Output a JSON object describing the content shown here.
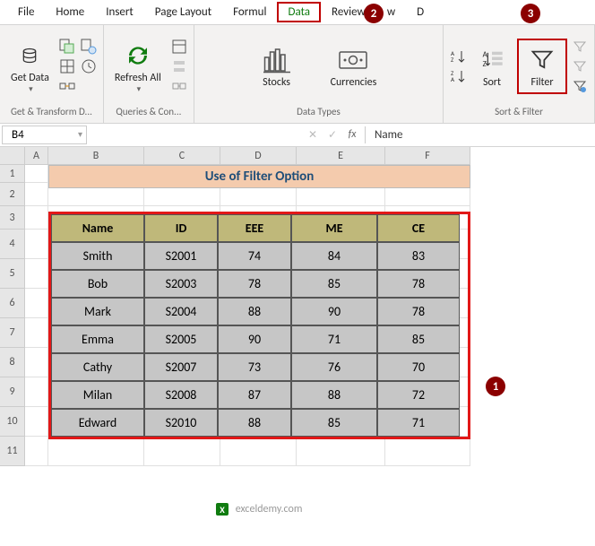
{
  "tabs": [
    "File",
    "Home",
    "Insert",
    "Page Layout",
    "Formul",
    "Data",
    "Review",
    "w",
    "D"
  ],
  "activeTab": "Data",
  "ribbon": {
    "getData": "Get Data",
    "refreshAll": "Refresh All",
    "stocks": "Stocks",
    "currencies": "Currencies",
    "sort": "Sort",
    "filter": "Filter",
    "group1": "Get & Transform D...",
    "group2": "Queries & Con...",
    "group3": "Data Types",
    "group4": "Sort & Filter"
  },
  "nameBox": "B4",
  "formulaBar": "Name",
  "colHeaders": [
    "A",
    "B",
    "C",
    "D",
    "E",
    "F"
  ],
  "rowHeaders": [
    "1",
    "2",
    "3",
    "4",
    "5",
    "6",
    "7",
    "8",
    "9",
    "10",
    "11"
  ],
  "title": "Use of Filter Option",
  "table": {
    "headers": [
      "Name",
      "ID",
      "EEE",
      "ME",
      "CE"
    ],
    "rows": [
      [
        "Smith",
        "S2001",
        "74",
        "84",
        "83"
      ],
      [
        "Bob",
        "S2003",
        "78",
        "85",
        "78"
      ],
      [
        "Mark",
        "S2004",
        "88",
        "90",
        "78"
      ],
      [
        "Emma",
        "S2005",
        "90",
        "71",
        "85"
      ],
      [
        "Cathy",
        "S2007",
        "73",
        "76",
        "70"
      ],
      [
        "Milan",
        "S2008",
        "87",
        "88",
        "72"
      ],
      [
        "Edward",
        "S2010",
        "88",
        "85",
        "71"
      ]
    ]
  },
  "callouts": {
    "one": "1",
    "two": "2",
    "three": "3"
  },
  "watermark": "exceldemy.com"
}
